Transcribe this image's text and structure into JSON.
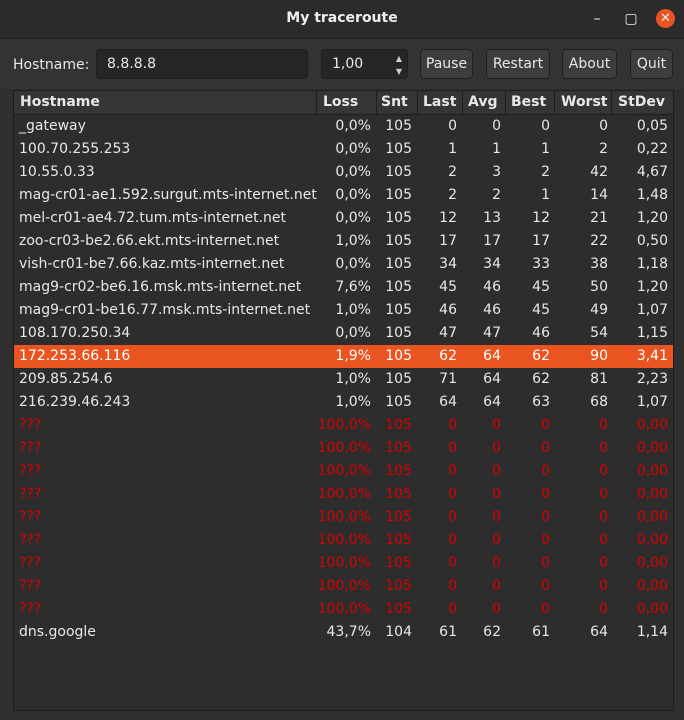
{
  "window": {
    "title": "My traceroute"
  },
  "toolbar": {
    "hostname_label": "Hostname:",
    "hostname_value": "8.8.8.8",
    "interval_value": "1,00",
    "pause_label": "Pause",
    "restart_label": "Restart",
    "about_label": "About",
    "quit_label": "Quit"
  },
  "table": {
    "columns": [
      "Hostname",
      "Loss",
      "Snt",
      "Last",
      "Avg",
      "Best",
      "Worst",
      "StDev"
    ],
    "selected_row": 10,
    "rows": [
      [
        "_gateway",
        "0,0%",
        "105",
        "0",
        "0",
        "0",
        "0",
        "0,05"
      ],
      [
        "100.70.255.253",
        "0,0%",
        "105",
        "1",
        "1",
        "1",
        "2",
        "0,22"
      ],
      [
        "10.55.0.33",
        "0,0%",
        "105",
        "2",
        "3",
        "2",
        "42",
        "4,67"
      ],
      [
        "mag-cr01-ae1.592.surgut.mts-internet.net",
        "0,0%",
        "105",
        "2",
        "2",
        "1",
        "14",
        "1,48"
      ],
      [
        "mel-cr01-ae4.72.tum.mts-internet.net",
        "0,0%",
        "105",
        "12",
        "13",
        "12",
        "21",
        "1,20"
      ],
      [
        "zoo-cr03-be2.66.ekt.mts-internet.net",
        "1,0%",
        "105",
        "17",
        "17",
        "17",
        "22",
        "0,50"
      ],
      [
        "vish-cr01-be7.66.kaz.mts-internet.net",
        "0,0%",
        "105",
        "34",
        "34",
        "33",
        "38",
        "1,18"
      ],
      [
        "mag9-cr02-be6.16.msk.mts-internet.net",
        "7,6%",
        "105",
        "45",
        "46",
        "45",
        "50",
        "1,20"
      ],
      [
        "mag9-cr01-be16.77.msk.mts-internet.net",
        "1,0%",
        "105",
        "46",
        "46",
        "45",
        "49",
        "1,07"
      ],
      [
        "108.170.250.34",
        "0,0%",
        "105",
        "47",
        "47",
        "46",
        "54",
        "1,15"
      ],
      [
        "172.253.66.116",
        "1,9%",
        "105",
        "62",
        "64",
        "62",
        "90",
        "3,41"
      ],
      [
        "209.85.254.6",
        "1,0%",
        "105",
        "71",
        "64",
        "62",
        "81",
        "2,23"
      ],
      [
        "216.239.46.243",
        "1,0%",
        "105",
        "64",
        "64",
        "63",
        "68",
        "1,07"
      ],
      [
        "???",
        "100,0%",
        "105",
        "0",
        "0",
        "0",
        "0",
        "0,00"
      ],
      [
        "???",
        "100,0%",
        "105",
        "0",
        "0",
        "0",
        "0",
        "0,00"
      ],
      [
        "???",
        "100,0%",
        "105",
        "0",
        "0",
        "0",
        "0",
        "0,00"
      ],
      [
        "???",
        "100,0%",
        "105",
        "0",
        "0",
        "0",
        "0",
        "0,00"
      ],
      [
        "???",
        "100,0%",
        "105",
        "0",
        "0",
        "0",
        "0",
        "0,00"
      ],
      [
        "???",
        "100,0%",
        "105",
        "0",
        "0",
        "0",
        "0",
        "0,00"
      ],
      [
        "???",
        "100,0%",
        "105",
        "0",
        "0",
        "0",
        "0",
        "0,00"
      ],
      [
        "???",
        "100,0%",
        "105",
        "0",
        "0",
        "0",
        "0",
        "0,00"
      ],
      [
        "???",
        "100,0%",
        "105",
        "0",
        "0",
        "0",
        "0",
        "0,00"
      ],
      [
        "dns.google",
        "43,7%",
        "104",
        "61",
        "62",
        "61",
        "64",
        "1,14"
      ]
    ]
  },
  "colors": {
    "accent": "#e95420",
    "timeout_text": "#d80000"
  }
}
